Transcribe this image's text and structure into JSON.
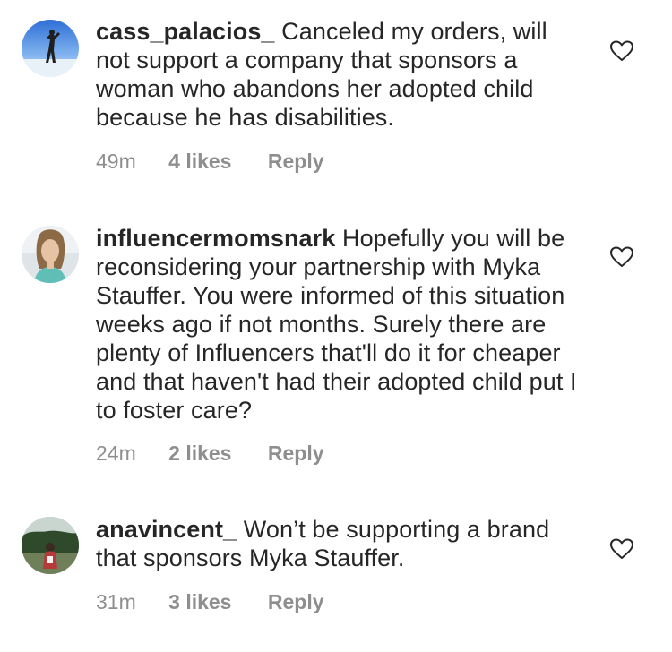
{
  "comments": [
    {
      "username": "cass_palacios_",
      "text": "Canceled my orders, will not support a company that sponsors a woman who abandons her adopted child because he has disabilities.",
      "time": "49m",
      "likes": "4 likes",
      "reply": "Reply"
    },
    {
      "username": "influencermomsnark",
      "text": "Hopefully you will be reconsidering your partnership with Myka Stauffer. You were informed of this situation weeks ago if not months. Surely there are plenty of Influencers that'll do it for cheaper and that haven't had their adopted child put I to foster care?",
      "time": "24m",
      "likes": "2 likes",
      "reply": "Reply"
    },
    {
      "username": "anavincent_",
      "text": "Won’t be supporting a brand that sponsors Myka Stauffer.",
      "time": "31m",
      "likes": "3 likes",
      "reply": "Reply"
    }
  ],
  "icons": {
    "like": "heart-outline-icon"
  },
  "colors": {
    "text": "#262626",
    "secondary": "#8e8e8e"
  }
}
